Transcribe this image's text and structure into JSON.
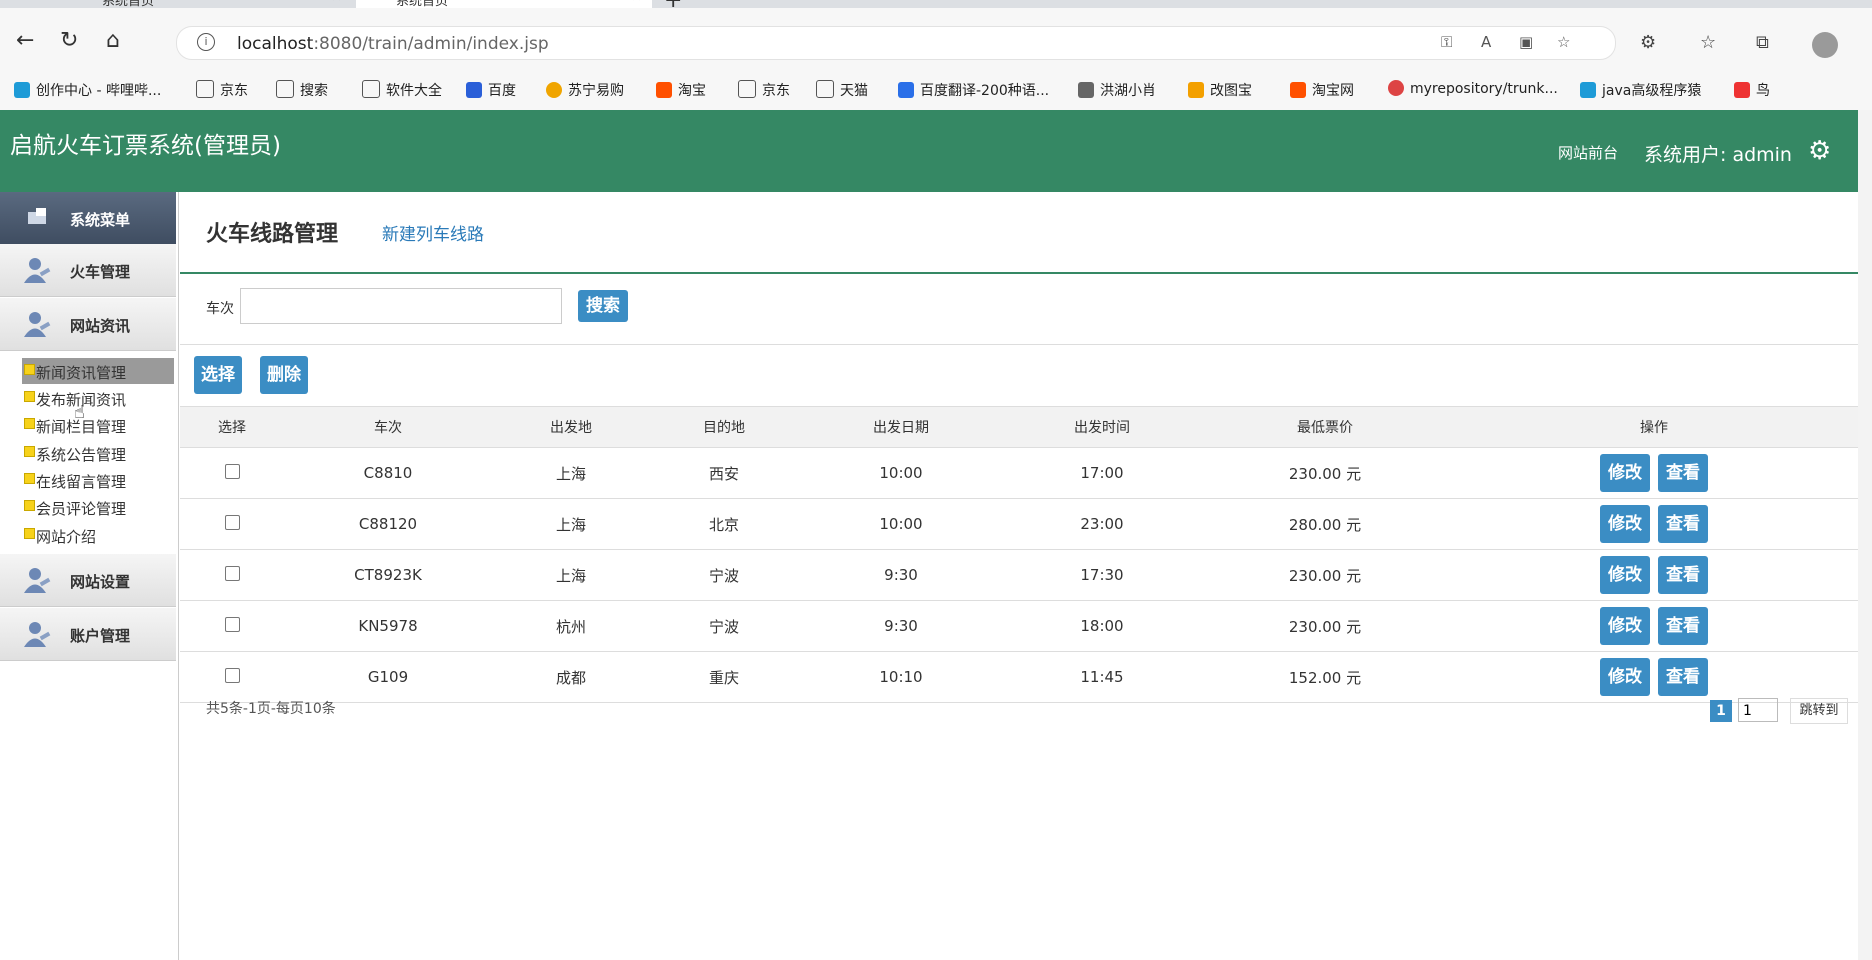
{
  "browser": {
    "tabs": [
      {
        "label": "系统首页"
      },
      {
        "label": "系统首页"
      }
    ],
    "url_host": "localhost",
    "url_rest": ":8080/train/admin/index.jsp",
    "bookmarks": [
      {
        "label": "创作中心 - 哔哩哔...",
        "color": "#1e9bd7"
      },
      {
        "label": "京东",
        "color": ""
      },
      {
        "label": "搜索",
        "color": ""
      },
      {
        "label": "软件大全",
        "color": ""
      },
      {
        "label": "百度",
        "color": "#2a5fd8"
      },
      {
        "label": "苏宁易购",
        "color": "#f0a500"
      },
      {
        "label": "淘宝",
        "color": "#ff5000"
      },
      {
        "label": "京东",
        "color": ""
      },
      {
        "label": "天猫",
        "color": ""
      },
      {
        "label": "百度翻译-200种语...",
        "color": "#2a6fe8"
      },
      {
        "label": "洪湖小肖",
        "color": "#666666"
      },
      {
        "label": "改图宝",
        "color": "#f3a000"
      },
      {
        "label": "淘宝网",
        "color": "#ff5000"
      },
      {
        "label": "myrepository/trunk...",
        "color": "#d44"
      },
      {
        "label": "java高级程序猿",
        "color": "#1e9bd7"
      },
      {
        "label": "鸟",
        "color": "#e33"
      }
    ]
  },
  "header": {
    "title": "启航火车订票系统(管理员)",
    "front_link": "网站前台",
    "user": "系统用户: admin",
    "bg_color": "#358864"
  },
  "sidebar": {
    "head": "系统菜单",
    "menus": [
      "火车管理",
      "网站资讯",
      "网站设置",
      "账户管理"
    ],
    "subitems": [
      "新闻资讯管理",
      "发布新闻资讯",
      "新闻栏目管理",
      "系统公告管理",
      "在线留言管理",
      "会员评论管理",
      "网站介绍"
    ]
  },
  "main": {
    "title": "火车线路管理",
    "new_link": "新建列车线路",
    "search_label": "车次",
    "search_button": "搜索",
    "select_button": "选择",
    "delete_button": "删除",
    "columns": [
      "选择",
      "车次",
      "出发地",
      "目的地",
      "出发日期",
      "出发时间",
      "最低票价",
      "操作"
    ],
    "rows": [
      {
        "train": "C8810",
        "from": "上海",
        "to": "西安",
        "date": "10:00",
        "time": "17:00",
        "price": "230.00 元"
      },
      {
        "train": "C88120",
        "from": "上海",
        "to": "北京",
        "date": "10:00",
        "time": "23:00",
        "price": "280.00 元"
      },
      {
        "train": "CT8923K",
        "from": "上海",
        "to": "宁波",
        "date": "9:30",
        "time": "17:30",
        "price": "230.00 元"
      },
      {
        "train": "KN5978",
        "from": "杭州",
        "to": "宁波",
        "date": "9:30",
        "time": "18:00",
        "price": "230.00 元"
      },
      {
        "train": "G109",
        "from": "成都",
        "to": "重庆",
        "date": "10:10",
        "time": "11:45",
        "price": "152.00 元"
      }
    ],
    "edit_label": "修改",
    "view_label": "查看",
    "pager_info": "共5条-1页-每页10条",
    "current_page": "1",
    "page_input": "1",
    "jump_label": "跳转到"
  }
}
